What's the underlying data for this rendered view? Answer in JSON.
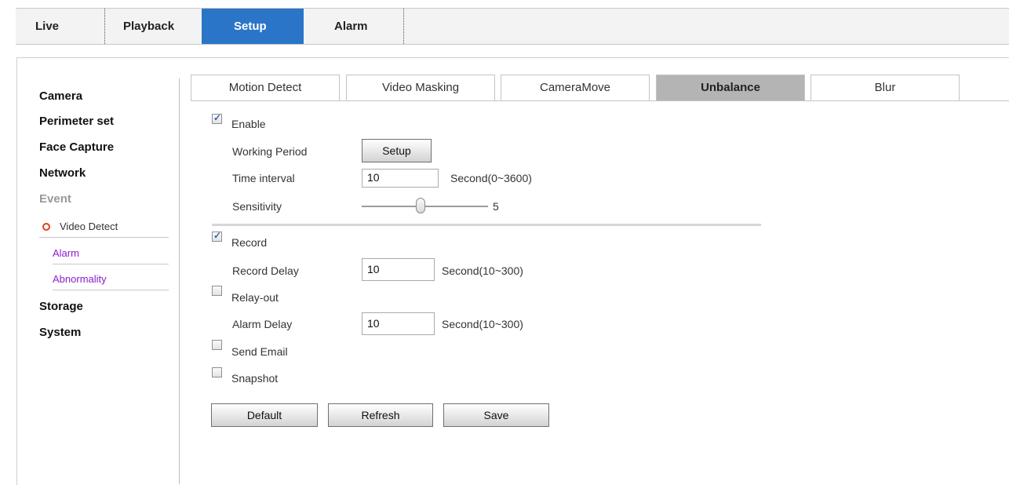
{
  "topnav": {
    "live": "Live",
    "playback": "Playback",
    "setup": "Setup",
    "alarm": "Alarm"
  },
  "sidebar": {
    "camera": "Camera",
    "perimeter": "Perimeter set",
    "face_capture": "Face Capture",
    "network": "Network",
    "event": "Event",
    "video_detect": "Video Detect",
    "alarm": "Alarm",
    "abnormality": "Abnormality",
    "storage": "Storage",
    "system": "System"
  },
  "tabs": {
    "motion_detect": "Motion Detect",
    "video_masking": "Video Masking",
    "camera_move": "CameraMove",
    "unbalance": "Unbalance",
    "blur": "Blur"
  },
  "form": {
    "enable_label": "Enable",
    "enable_checked": true,
    "working_period_label": "Working Period",
    "setup_button": "Setup",
    "time_interval_label": "Time interval",
    "time_interval_value": "10",
    "time_interval_unit": "Second(0~3600)",
    "sensitivity_label": "Sensitivity",
    "sensitivity_value": "5",
    "record_label": "Record",
    "record_checked": true,
    "record_delay_label": "Record Delay",
    "record_delay_value": "10",
    "record_delay_unit": "Second(10~300)",
    "relay_out_label": "Relay-out",
    "relay_out_checked": false,
    "alarm_delay_label": "Alarm Delay",
    "alarm_delay_value": "10",
    "alarm_delay_unit": "Second(10~300)",
    "send_email_label": "Send Email",
    "send_email_checked": false,
    "snapshot_label": "Snapshot",
    "snapshot_checked": false
  },
  "buttons": {
    "default": "Default",
    "refresh": "Refresh",
    "save": "Save"
  },
  "colors": {
    "active_tab": "#2b75c8",
    "active_subtab": "#b4b4b4",
    "submenu_link": "#8a1ec8",
    "current_dot": "#e2401f"
  }
}
